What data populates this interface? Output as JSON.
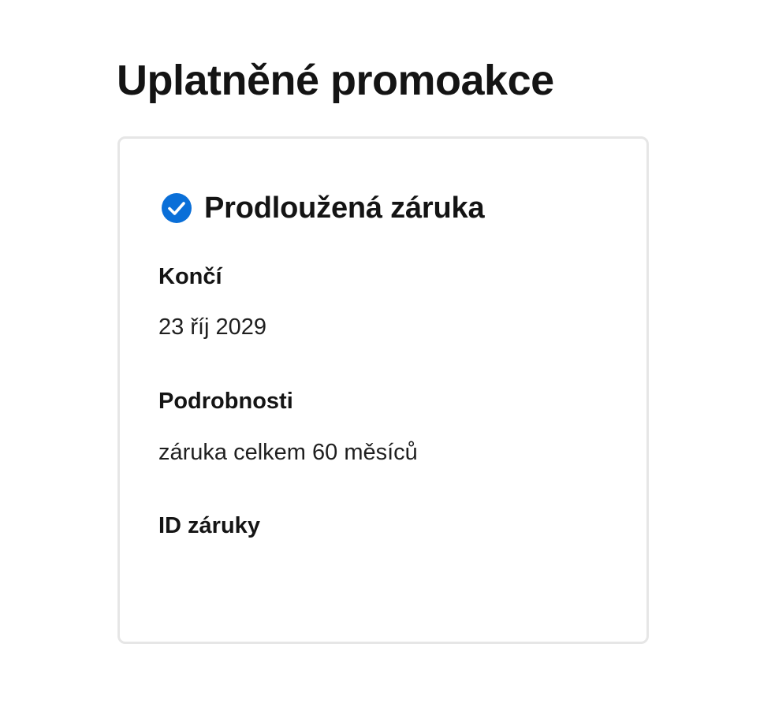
{
  "page": {
    "title": "Uplatněné promoakce"
  },
  "promo_card": {
    "icon": "check-circle-icon",
    "icon_color": "#0a6fd8",
    "title": "Prodloužená záruka",
    "fields": [
      {
        "label": "Končí",
        "value": "23 říj 2029"
      },
      {
        "label": "Podrobnosti",
        "value": "záruka celkem 60 měsíců"
      },
      {
        "label": "ID záruky",
        "value": ""
      }
    ]
  }
}
